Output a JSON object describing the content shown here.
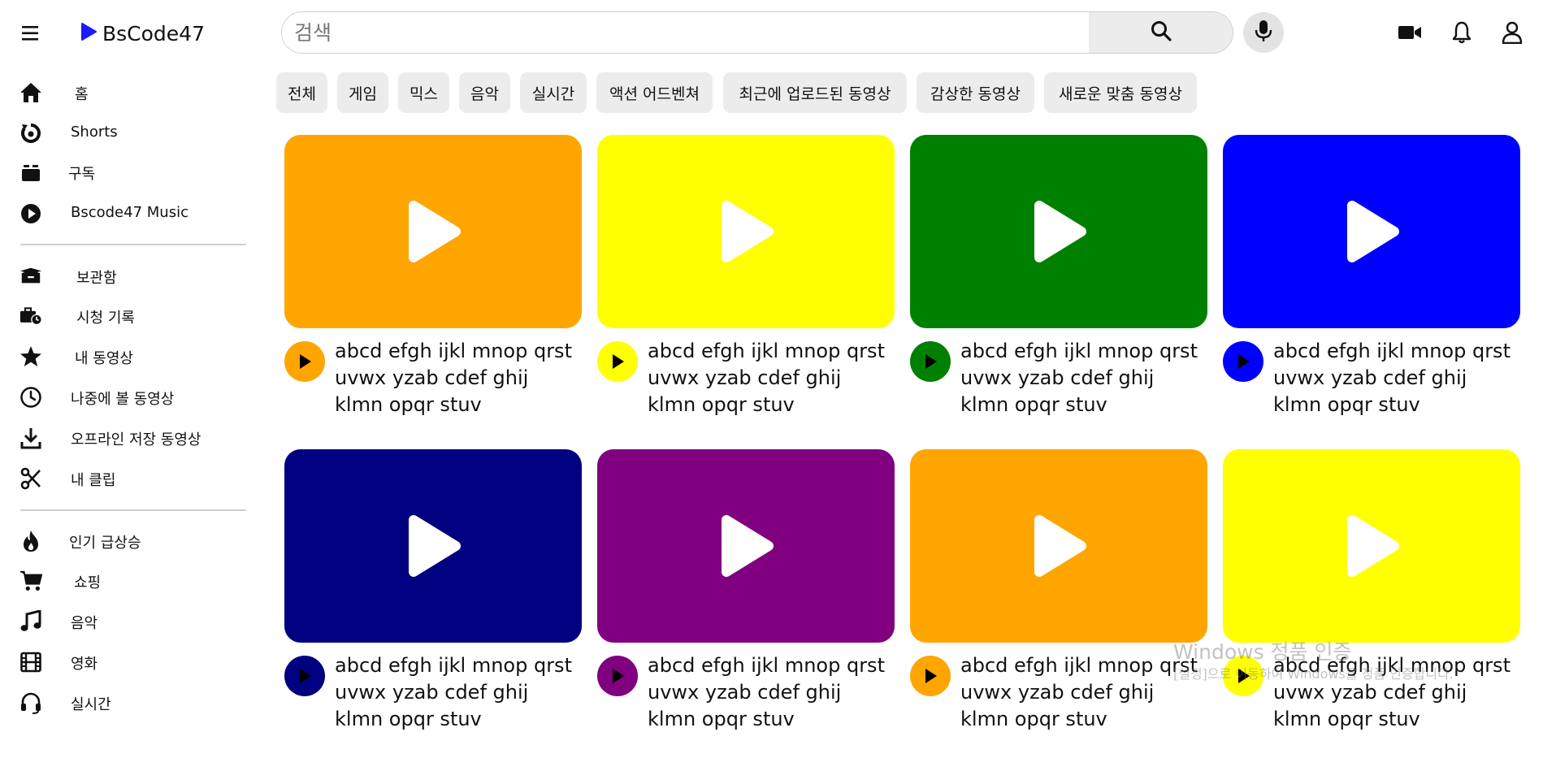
{
  "header": {
    "logo_text": "BsCode47",
    "search_placeholder": "검색",
    "icons": [
      "menu-icon",
      "play-logo-icon",
      "search-icon",
      "microphone-icon",
      "video-camera-icon",
      "bell-icon",
      "user-icon"
    ]
  },
  "sidebar": {
    "group1": [
      {
        "label": "홈",
        "icon": "home-icon"
      },
      {
        "label": "Shorts",
        "icon": "shorts-icon"
      },
      {
        "label": "구독",
        "icon": "subscriptions-icon"
      },
      {
        "label": "Bscode47 Music",
        "icon": "music-play-icon"
      }
    ],
    "group2": [
      {
        "label": "보관함",
        "icon": "library-box-icon"
      },
      {
        "label": "시청 기록",
        "icon": "history-briefcase-icon"
      },
      {
        "label": "내 동영상",
        "icon": "star-icon"
      },
      {
        "label": "나중에 볼 동영상",
        "icon": "clock-icon"
      },
      {
        "label": "오프라인 저장 동영상",
        "icon": "download-icon"
      },
      {
        "label": "내 클립",
        "icon": "scissors-icon"
      }
    ],
    "group3": [
      {
        "label": "인기 급상승",
        "icon": "fire-icon"
      },
      {
        "label": "쇼핑",
        "icon": "cart-icon"
      },
      {
        "label": "음악",
        "icon": "music-note-icon"
      },
      {
        "label": "영화",
        "icon": "film-icon"
      },
      {
        "label": "실시간",
        "icon": "live-headset-icon"
      }
    ]
  },
  "chips": [
    "전체",
    "게임",
    "믹스",
    "음악",
    "실시간",
    "액션 어드벤쳐",
    "최근에 업로드된 동영상",
    "감상한 동영상",
    "새로운 맞춤 동영상"
  ],
  "videos": [
    {
      "title": "abcd efgh ijkl mnop qrst uvwx yzab cdef ghij klmn opqr stuv",
      "color": "#FFA500"
    },
    {
      "title": "abcd efgh ijkl mnop qrst uvwx yzab cdef ghij klmn opqr stuv",
      "color": "#FFFF00"
    },
    {
      "title": "abcd efgh ijkl mnop qrst uvwx yzab cdef ghij klmn opqr stuv",
      "color": "#008000"
    },
    {
      "title": "abcd efgh ijkl mnop qrst uvwx yzab cdef ghij klmn opqr stuv",
      "color": "#0000FF"
    },
    {
      "title": "abcd efgh ijkl mnop qrst uvwx yzab cdef ghij klmn opqr stuv",
      "color": "#000080"
    },
    {
      "title": "abcd efgh ijkl mnop qrst uvwx yzab cdef ghij klmn opqr stuv",
      "color": "#800080"
    },
    {
      "title": "abcd efgh ijkl mnop qrst uvwx yzab cdef ghij klmn opqr stuv",
      "color": "#FFA500"
    },
    {
      "title": "abcd efgh ijkl mnop qrst uvwx yzab cdef ghij klmn opqr stuv",
      "color": "#FFFF00"
    }
  ],
  "watermark": {
    "title": "Windows 정품 인증",
    "subtitle": "[설정]으로 이동하여 Windows를 정품 인증합니다."
  }
}
